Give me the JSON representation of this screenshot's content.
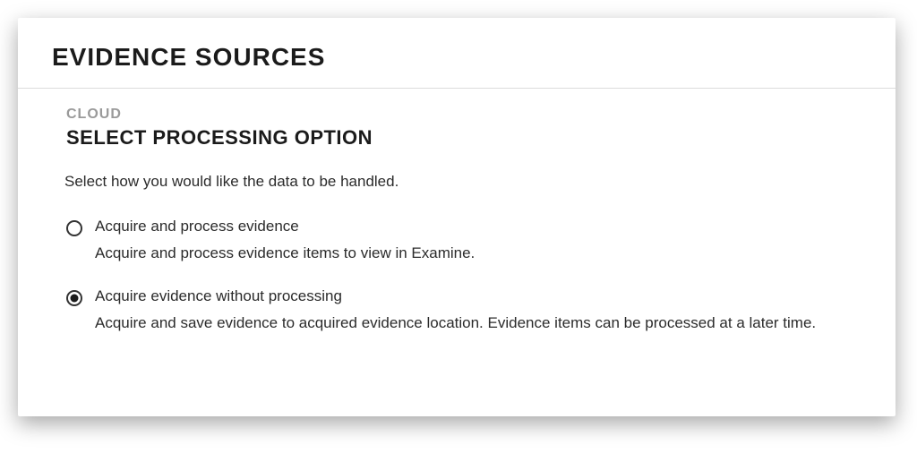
{
  "header": {
    "title": "EVIDENCE SOURCES"
  },
  "section": {
    "breadcrumb": "CLOUD",
    "title": "SELECT PROCESSING OPTION",
    "instruction": "Select how you would like the data to be handled."
  },
  "options": [
    {
      "label": "Acquire and process evidence",
      "description": "Acquire and process evidence items to view in Examine.",
      "selected": false
    },
    {
      "label": "Acquire evidence without processing",
      "description": "Acquire and save evidence to acquired evidence location. Evidence items can be processed at a later time.",
      "selected": true
    }
  ]
}
